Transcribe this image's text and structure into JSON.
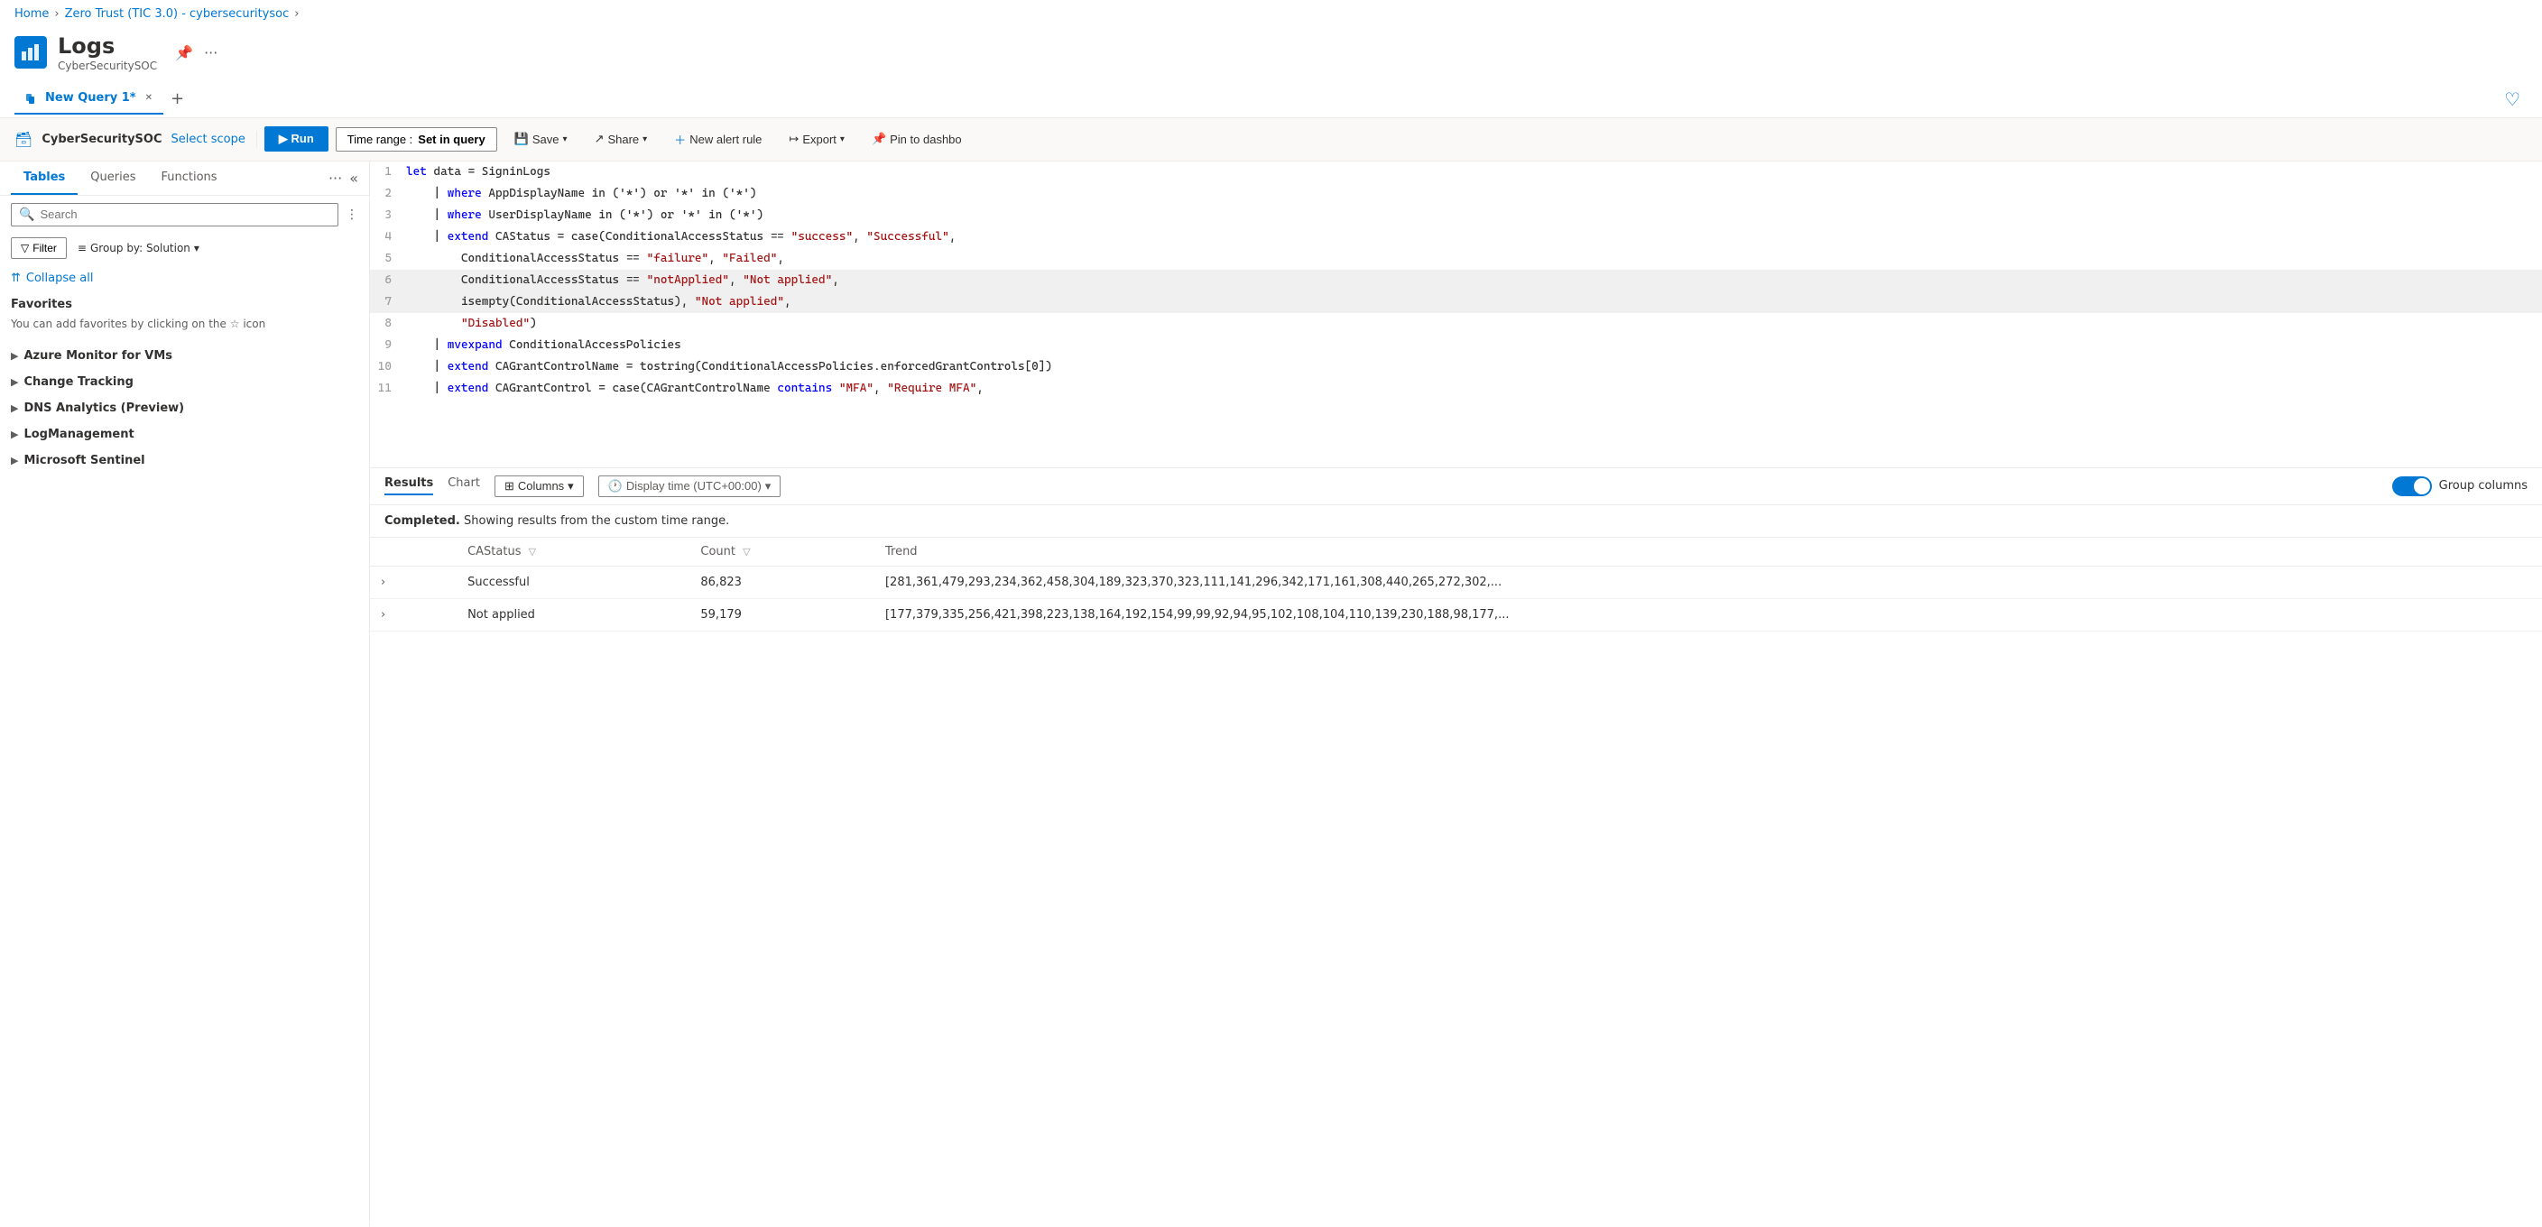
{
  "breadcrumb": {
    "home": "Home",
    "workspace": "Zero Trust (TIC 3.0) - cybersecuritysoc",
    "sep": "›"
  },
  "app": {
    "title": "Logs",
    "subtitle": "CyberSecuritySOC"
  },
  "tab": {
    "label": "New Query 1*",
    "add": "+",
    "heart": "♡"
  },
  "toolbar": {
    "scope": "CyberSecuritySOC",
    "select_scope": "Select scope",
    "run": "▶ Run",
    "time_range_label": "Time range :",
    "time_range_value": "Set in query",
    "save": "Save",
    "share": "Share",
    "new_alert": "New alert rule",
    "export": "Export",
    "pin": "Pin to dashbo"
  },
  "sidebar": {
    "tabs": [
      "Tables",
      "Queries",
      "Functions"
    ],
    "more": "···",
    "search_placeholder": "Search",
    "filter": "Filter",
    "group_by": "Group by: Solution",
    "collapse_all": "Collapse all",
    "favorites_title": "Favorites",
    "favorites_hint": "You can add favorites by clicking on the",
    "favorites_hint2": "icon",
    "star": "☆",
    "items": [
      {
        "label": "Azure Monitor for VMs"
      },
      {
        "label": "Change Tracking"
      },
      {
        "label": "DNS Analytics (Preview)"
      },
      {
        "label": "LogManagement"
      },
      {
        "label": "Microsoft Sentinel"
      }
    ]
  },
  "code": {
    "lines": [
      {
        "num": 1,
        "content": "let data = SigninLogs"
      },
      {
        "num": 2,
        "content": "    | where AppDisplayName in ('*') or '*' in ('*')"
      },
      {
        "num": 3,
        "content": "    | where UserDisplayName in ('*') or '*' in ('*')"
      },
      {
        "num": 4,
        "content": "    | extend CAStatus = case(ConditionalAccessStatus == \"success\", \"Successful\","
      },
      {
        "num": 5,
        "content": "        ConditionalAccessStatus == \"failure\", \"Failed\","
      },
      {
        "num": 6,
        "content": "        ConditionalAccessStatus == \"notApplied\", \"Not applied\","
      },
      {
        "num": 7,
        "content": "        isempty(ConditionalAccessStatus), \"Not applied\","
      },
      {
        "num": 8,
        "content": "        \"Disabled\")"
      },
      {
        "num": 9,
        "content": "    | mvexpand ConditionalAccessPolicies"
      },
      {
        "num": 10,
        "content": "    | extend CAGrantControlName = tostring(ConditionalAccessPolicies.enforcedGrantControls[0])"
      },
      {
        "num": 11,
        "content": "    | extend CAGrantControl = case(CAGrantControlName contains \"MFA\", \"Require MFA\","
      }
    ]
  },
  "results": {
    "tabs": [
      "Results",
      "Chart"
    ],
    "columns_label": "Columns",
    "display_time": "Display time (UTC+00:00)",
    "group_columns": "Group columns",
    "status_text": "Completed.",
    "status_detail": "Showing results from the custom time range.",
    "columns": [
      "CAStatus",
      "Count",
      "Trend"
    ],
    "rows": [
      {
        "status": "Successful",
        "count": "86,823",
        "trend": "[281,361,479,293,234,362,458,304,189,323,370,323,111,141,296,342,171,161,308,440,265,272,302,..."
      },
      {
        "status": "Not applied",
        "count": "59,179",
        "trend": "[177,379,335,256,421,398,223,138,164,192,154,99,99,92,94,95,102,108,104,110,139,230,188,98,177,..."
      }
    ]
  }
}
